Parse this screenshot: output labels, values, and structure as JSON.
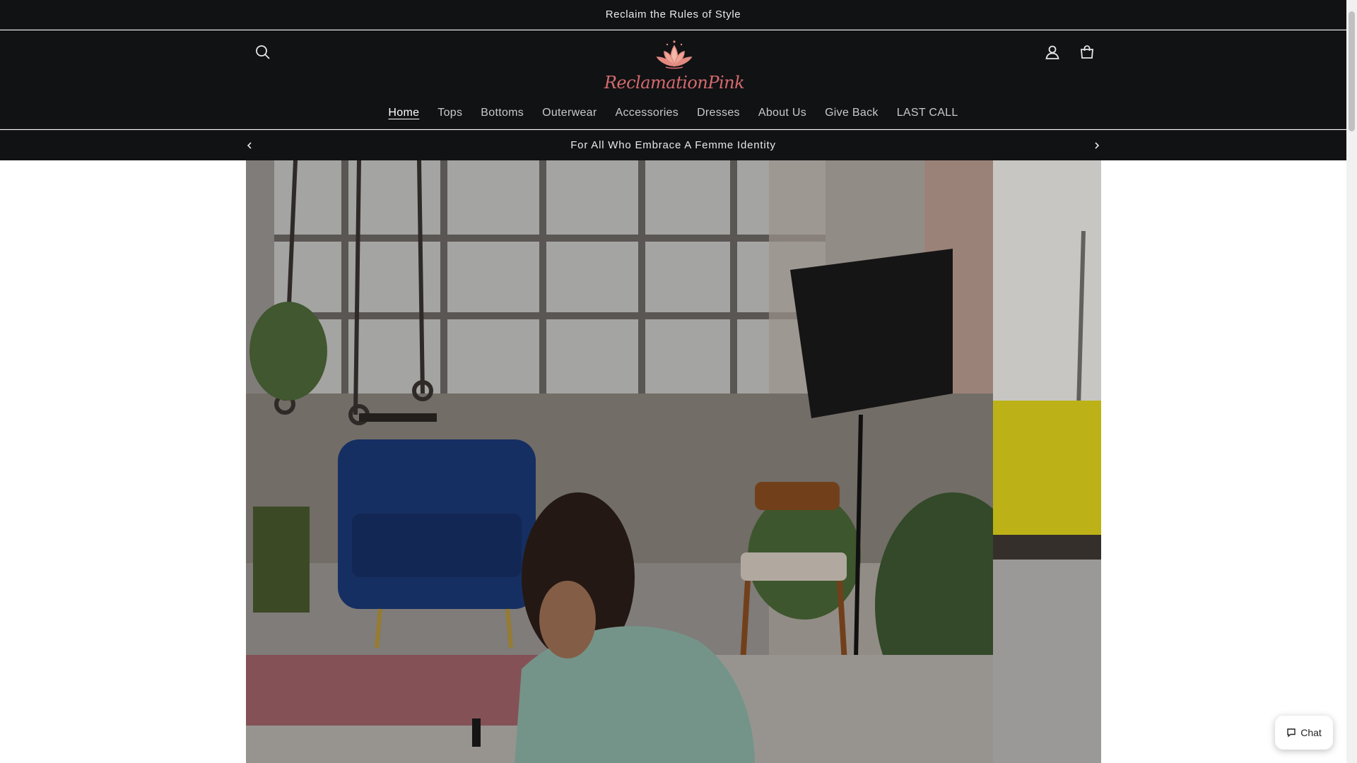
{
  "announcement": "Reclaim the Rules of Style",
  "logo": {
    "text": "ReclamationPink"
  },
  "header_icons": {
    "search": "search-icon",
    "account": "account-icon",
    "cart": "cart-icon"
  },
  "nav": {
    "items": [
      {
        "label": "Home",
        "active": true
      },
      {
        "label": "Tops"
      },
      {
        "label": "Bottoms"
      },
      {
        "label": "Outerwear"
      },
      {
        "label": "Accessories"
      },
      {
        "label": "Dresses"
      },
      {
        "label": "About Us"
      },
      {
        "label": "Give Back"
      },
      {
        "label": "LAST CALL"
      }
    ]
  },
  "promo": {
    "text": "For All Who Embrace A Femme Identity",
    "prev_icon": "chevron-left-icon",
    "next_icon": "chevron-right-icon"
  },
  "chat": {
    "label": "Chat"
  },
  "colors": {
    "header_bg": "#111214",
    "logo_pink": "#d56a6e",
    "text_light": "#eaeaea"
  }
}
